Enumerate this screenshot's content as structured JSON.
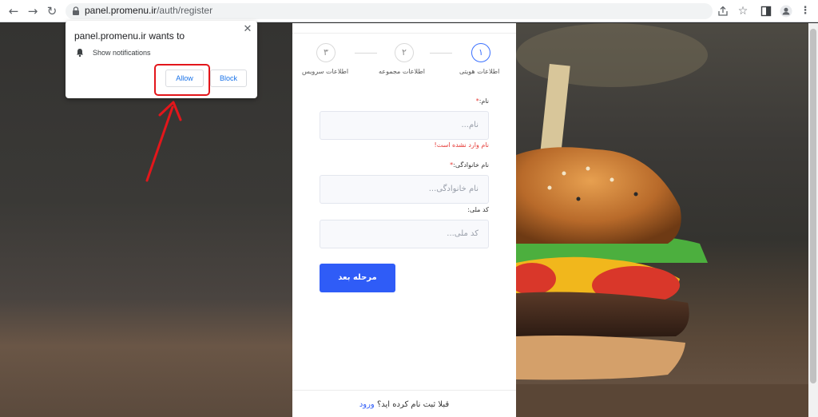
{
  "browser": {
    "url_host": "panel.promenu.ir",
    "url_path": "/auth/register"
  },
  "popup": {
    "title": "panel.promenu.ir wants to",
    "permission": "Show notifications",
    "allow_label": "Allow",
    "block_label": "Block",
    "close_icon": "close-icon",
    "highlight_color": "#e3161b"
  },
  "steps": [
    {
      "number": "۱",
      "label": "اطلاعات هویتی",
      "active": true
    },
    {
      "number": "۲",
      "label": "اطلاعات مجموعه",
      "active": false
    },
    {
      "number": "۳",
      "label": "اطلاعات سرویس",
      "active": false
    }
  ],
  "form": {
    "name": {
      "label": "نام:",
      "required_mark": "*",
      "placeholder": "نام...",
      "error": "نام وارد نشده است!"
    },
    "family": {
      "label": "نام خانوادگی:",
      "required_mark": "*",
      "placeholder": "نام خانوادگی..."
    },
    "national_code": {
      "label": "کد ملی:",
      "placeholder": "کد ملی..."
    },
    "next_label": "مرحله بعد"
  },
  "footer": {
    "question": "قبلا ثبت نام کرده اید؟",
    "login_link": "ورود"
  },
  "colors": {
    "accent": "#2f5cf7",
    "error": "#e53935"
  }
}
